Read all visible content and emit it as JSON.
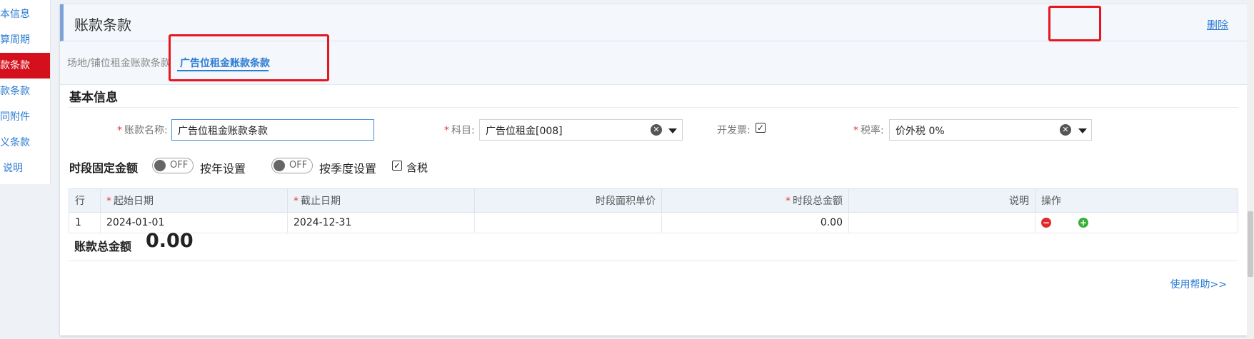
{
  "sidebar": {
    "items": [
      {
        "label": "基本信息"
      },
      {
        "label": "结算周期"
      },
      {
        "label": "账款条款"
      },
      {
        "label": "存款条款"
      },
      {
        "label": "合同附件"
      },
      {
        "label": "定义条款"
      },
      {
        "label": "说明"
      }
    ]
  },
  "panel": {
    "title": "账款条款",
    "delete_label": "删除",
    "tabs": [
      {
        "label": "场地/铺位租金账款条款"
      },
      {
        "label": "广告位租金账款条款"
      }
    ]
  },
  "basic": {
    "section_title": "基本信息",
    "name_label": "账款名称:",
    "name_value": "广告位租金账款条款",
    "subject_label": "科目:",
    "subject_value": "广告位租金[008]",
    "invoice_label": "开发票:",
    "invoice_checked": true,
    "tax_label": "税率:",
    "tax_value": "价外税 0%",
    "required_mark": "*"
  },
  "period": {
    "section_title": "时段固定金额",
    "toggle_off": "OFF",
    "by_year": "按年设置",
    "by_quarter": "按季度设置",
    "tax_included": "含税",
    "columns": [
      "行",
      "起始日期",
      "截止日期",
      "时段面积单价",
      "时段总金额",
      "说明",
      "操作"
    ],
    "rows": [
      {
        "no": "1",
        "start": "2024-01-01",
        "end": "2024-12-31",
        "unit_price": "",
        "total": "0.00",
        "note": ""
      }
    ]
  },
  "summary": {
    "total_label": "账款总金额",
    "total_value": "0.00"
  },
  "help_label": "使用帮助>>",
  "colors": {
    "accent": "#2a7bd3",
    "active_nav": "#d4101c",
    "annotation": "#e8141e"
  }
}
